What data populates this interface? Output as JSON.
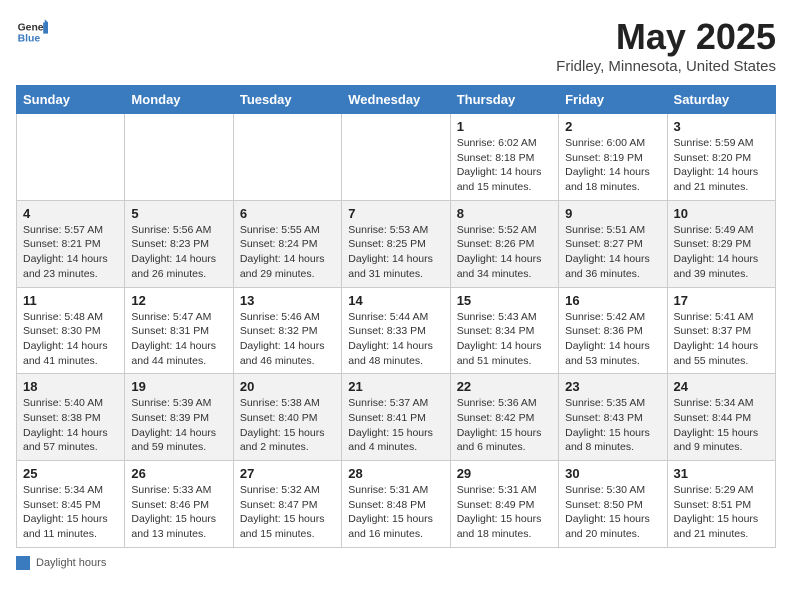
{
  "header": {
    "logo_general": "General",
    "logo_blue": "Blue",
    "title": "May 2025",
    "subtitle": "Fridley, Minnesota, United States"
  },
  "days_of_week": [
    "Sunday",
    "Monday",
    "Tuesday",
    "Wednesday",
    "Thursday",
    "Friday",
    "Saturday"
  ],
  "weeks": [
    [
      {
        "num": "",
        "detail": ""
      },
      {
        "num": "",
        "detail": ""
      },
      {
        "num": "",
        "detail": ""
      },
      {
        "num": "",
        "detail": ""
      },
      {
        "num": "1",
        "detail": "Sunrise: 6:02 AM\nSunset: 8:18 PM\nDaylight: 14 hours\nand 15 minutes."
      },
      {
        "num": "2",
        "detail": "Sunrise: 6:00 AM\nSunset: 8:19 PM\nDaylight: 14 hours\nand 18 minutes."
      },
      {
        "num": "3",
        "detail": "Sunrise: 5:59 AM\nSunset: 8:20 PM\nDaylight: 14 hours\nand 21 minutes."
      }
    ],
    [
      {
        "num": "4",
        "detail": "Sunrise: 5:57 AM\nSunset: 8:21 PM\nDaylight: 14 hours\nand 23 minutes."
      },
      {
        "num": "5",
        "detail": "Sunrise: 5:56 AM\nSunset: 8:23 PM\nDaylight: 14 hours\nand 26 minutes."
      },
      {
        "num": "6",
        "detail": "Sunrise: 5:55 AM\nSunset: 8:24 PM\nDaylight: 14 hours\nand 29 minutes."
      },
      {
        "num": "7",
        "detail": "Sunrise: 5:53 AM\nSunset: 8:25 PM\nDaylight: 14 hours\nand 31 minutes."
      },
      {
        "num": "8",
        "detail": "Sunrise: 5:52 AM\nSunset: 8:26 PM\nDaylight: 14 hours\nand 34 minutes."
      },
      {
        "num": "9",
        "detail": "Sunrise: 5:51 AM\nSunset: 8:27 PM\nDaylight: 14 hours\nand 36 minutes."
      },
      {
        "num": "10",
        "detail": "Sunrise: 5:49 AM\nSunset: 8:29 PM\nDaylight: 14 hours\nand 39 minutes."
      }
    ],
    [
      {
        "num": "11",
        "detail": "Sunrise: 5:48 AM\nSunset: 8:30 PM\nDaylight: 14 hours\nand 41 minutes."
      },
      {
        "num": "12",
        "detail": "Sunrise: 5:47 AM\nSunset: 8:31 PM\nDaylight: 14 hours\nand 44 minutes."
      },
      {
        "num": "13",
        "detail": "Sunrise: 5:46 AM\nSunset: 8:32 PM\nDaylight: 14 hours\nand 46 minutes."
      },
      {
        "num": "14",
        "detail": "Sunrise: 5:44 AM\nSunset: 8:33 PM\nDaylight: 14 hours\nand 48 minutes."
      },
      {
        "num": "15",
        "detail": "Sunrise: 5:43 AM\nSunset: 8:34 PM\nDaylight: 14 hours\nand 51 minutes."
      },
      {
        "num": "16",
        "detail": "Sunrise: 5:42 AM\nSunset: 8:36 PM\nDaylight: 14 hours\nand 53 minutes."
      },
      {
        "num": "17",
        "detail": "Sunrise: 5:41 AM\nSunset: 8:37 PM\nDaylight: 14 hours\nand 55 minutes."
      }
    ],
    [
      {
        "num": "18",
        "detail": "Sunrise: 5:40 AM\nSunset: 8:38 PM\nDaylight: 14 hours\nand 57 minutes."
      },
      {
        "num": "19",
        "detail": "Sunrise: 5:39 AM\nSunset: 8:39 PM\nDaylight: 14 hours\nand 59 minutes."
      },
      {
        "num": "20",
        "detail": "Sunrise: 5:38 AM\nSunset: 8:40 PM\nDaylight: 15 hours\nand 2 minutes."
      },
      {
        "num": "21",
        "detail": "Sunrise: 5:37 AM\nSunset: 8:41 PM\nDaylight: 15 hours\nand 4 minutes."
      },
      {
        "num": "22",
        "detail": "Sunrise: 5:36 AM\nSunset: 8:42 PM\nDaylight: 15 hours\nand 6 minutes."
      },
      {
        "num": "23",
        "detail": "Sunrise: 5:35 AM\nSunset: 8:43 PM\nDaylight: 15 hours\nand 8 minutes."
      },
      {
        "num": "24",
        "detail": "Sunrise: 5:34 AM\nSunset: 8:44 PM\nDaylight: 15 hours\nand 9 minutes."
      }
    ],
    [
      {
        "num": "25",
        "detail": "Sunrise: 5:34 AM\nSunset: 8:45 PM\nDaylight: 15 hours\nand 11 minutes."
      },
      {
        "num": "26",
        "detail": "Sunrise: 5:33 AM\nSunset: 8:46 PM\nDaylight: 15 hours\nand 13 minutes."
      },
      {
        "num": "27",
        "detail": "Sunrise: 5:32 AM\nSunset: 8:47 PM\nDaylight: 15 hours\nand 15 minutes."
      },
      {
        "num": "28",
        "detail": "Sunrise: 5:31 AM\nSunset: 8:48 PM\nDaylight: 15 hours\nand 16 minutes."
      },
      {
        "num": "29",
        "detail": "Sunrise: 5:31 AM\nSunset: 8:49 PM\nDaylight: 15 hours\nand 18 minutes."
      },
      {
        "num": "30",
        "detail": "Sunrise: 5:30 AM\nSunset: 8:50 PM\nDaylight: 15 hours\nand 20 minutes."
      },
      {
        "num": "31",
        "detail": "Sunrise: 5:29 AM\nSunset: 8:51 PM\nDaylight: 15 hours\nand 21 minutes."
      }
    ]
  ],
  "footer": {
    "label": "Daylight hours"
  },
  "colors": {
    "header_bg": "#3a7abf",
    "header_text": "#ffffff",
    "accent": "#3a7abf"
  }
}
